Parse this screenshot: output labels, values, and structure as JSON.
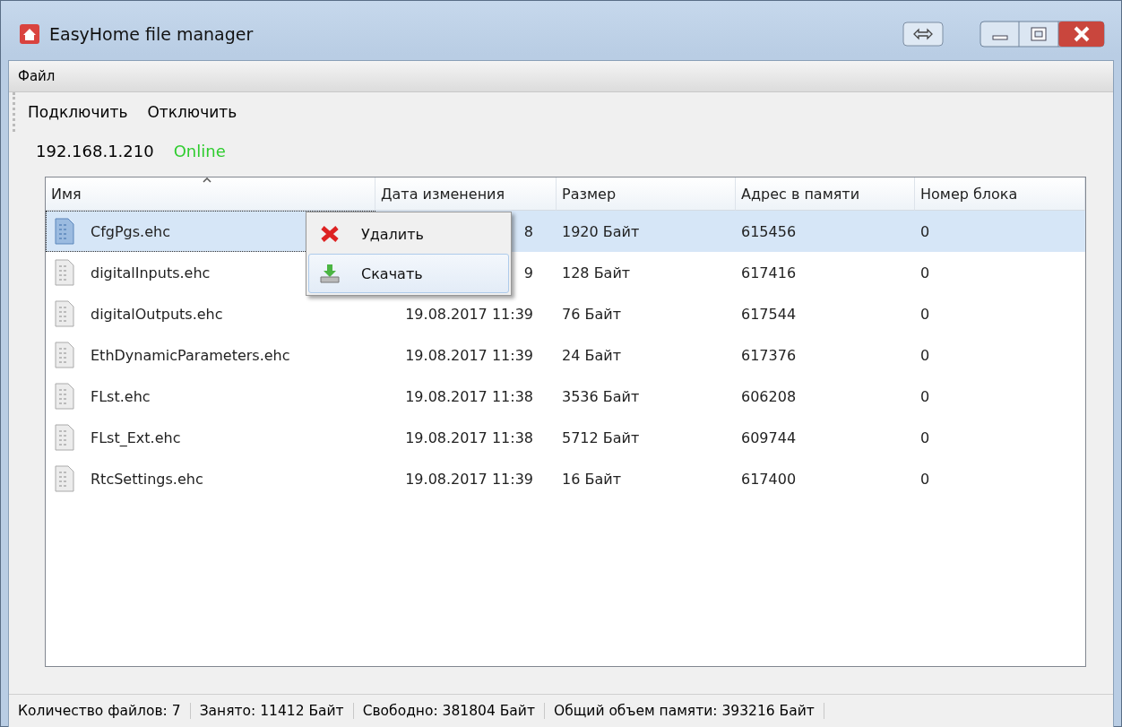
{
  "window": {
    "title": "EasyHome file manager"
  },
  "menu": [
    {
      "label": "Файл"
    }
  ],
  "toolbar": [
    "Подключить",
    "Отключить"
  ],
  "connection": {
    "address": "192.168.1.210",
    "status": "Online",
    "online": true
  },
  "table": {
    "columns": [
      {
        "label": "Имя",
        "sorted": true
      },
      {
        "label": "Дата изменения",
        "sorted": false
      },
      {
        "label": "Размер",
        "sorted": false
      },
      {
        "label": "Адрес в памяти",
        "sorted": false
      },
      {
        "label": "Номер блока",
        "sorted": false
      }
    ],
    "rows": [
      {
        "name": "CfgPgs.ehc",
        "date": "8",
        "size": "1920 Байт",
        "address": "615456",
        "block": "0",
        "selected": true
      },
      {
        "name": "digitalInputs.ehc",
        "date": "9",
        "size": "128 Байт",
        "address": "617416",
        "block": "0",
        "selected": false
      },
      {
        "name": "digitalOutputs.ehc",
        "date": "19.08.2017 11:39",
        "size": "76 Байт",
        "address": "617544",
        "block": "0",
        "selected": false
      },
      {
        "name": "EthDynamicParameters.ehc",
        "date": "19.08.2017 11:39",
        "size": "24 Байт",
        "address": "617376",
        "block": "0",
        "selected": false
      },
      {
        "name": "FLst.ehc",
        "date": "19.08.2017 11:38",
        "size": "3536 Байт",
        "address": "606208",
        "block": "0",
        "selected": false
      },
      {
        "name": "FLst_Ext.ehc",
        "date": "19.08.2017 11:38",
        "size": "5712 Байт",
        "address": "609744",
        "block": "0",
        "selected": false
      },
      {
        "name": "RtcSettings.ehc",
        "date": "19.08.2017 11:39",
        "size": "16 Байт",
        "address": "617400",
        "block": "0",
        "selected": false
      }
    ]
  },
  "context_menu": {
    "items": [
      {
        "label": "Удалить",
        "kind": "delete",
        "selected": false
      },
      {
        "label": "Скачать",
        "kind": "download",
        "selected": true
      }
    ]
  },
  "status_bar": [
    "Количество файлов: 7",
    "Занято: 11412 Байт",
    "Свободно: 381804 Байт",
    "Общий объем памяти: 393216 Байт"
  ]
}
